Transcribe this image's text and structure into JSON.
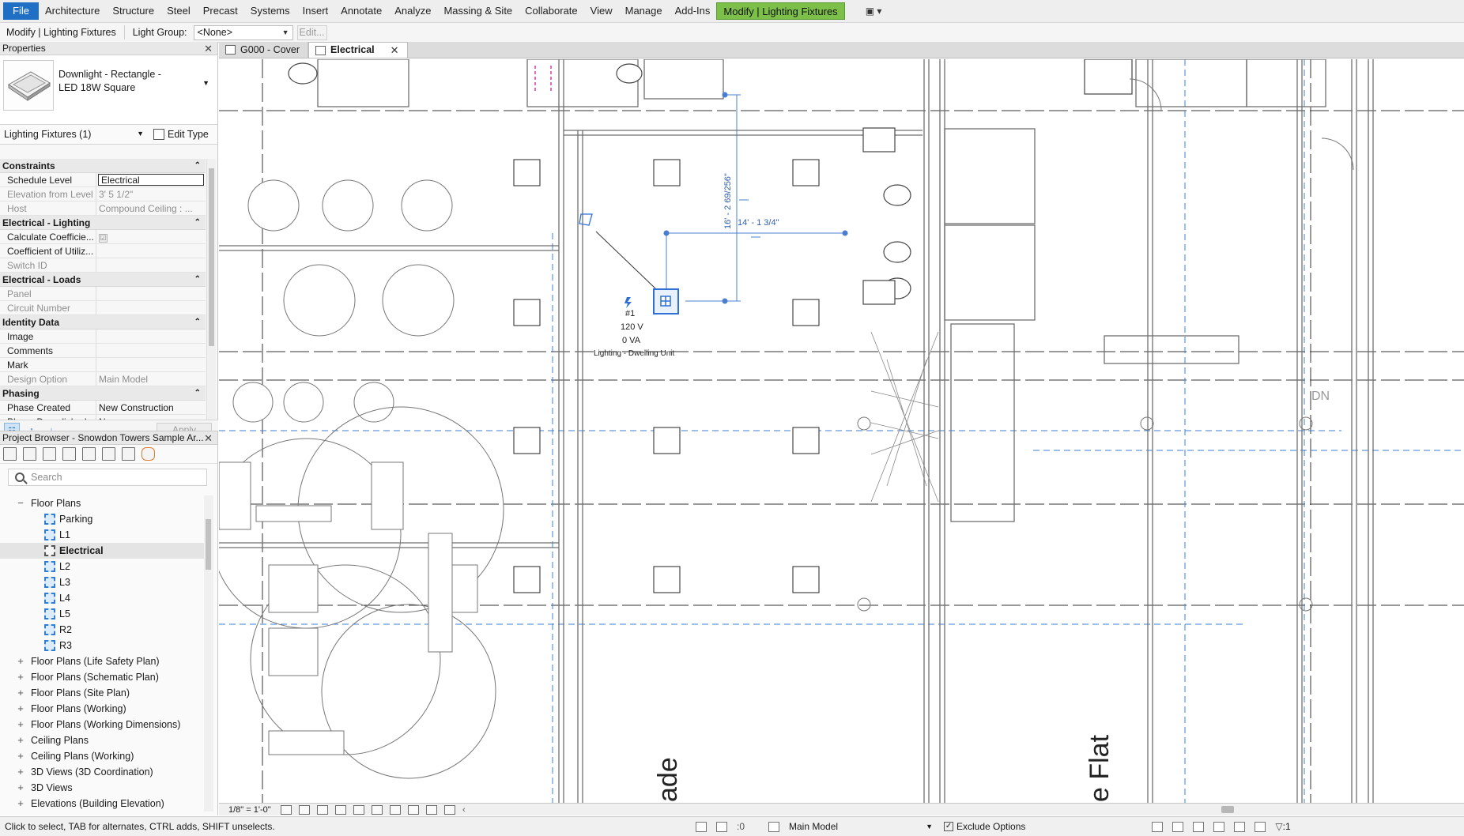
{
  "menu": {
    "file": "File",
    "tabs": [
      "Architecture",
      "Structure",
      "Steel",
      "Precast",
      "Systems",
      "Insert",
      "Annotate",
      "Analyze",
      "Massing & Site",
      "Collaborate",
      "View",
      "Manage",
      "Add-Ins"
    ],
    "context_tab": "Modify | Lighting Fixtures",
    "extra": "▣ ▾"
  },
  "options_bar": {
    "context": "Modify | Lighting Fixtures",
    "light_group_label": "Light Group:",
    "light_group_value": "<None>",
    "edit_button": "Edit..."
  },
  "properties": {
    "title": "Properties",
    "type_name": "Downlight - Rectangle - LED 18W Square",
    "instance_filter": "Lighting Fixtures (1)",
    "edit_type": "Edit Type",
    "groups": [
      {
        "name": "Constraints",
        "rows": [
          {
            "key": "Schedule Level",
            "value": "Electrical",
            "editing": true
          },
          {
            "key": "Elevation from Level",
            "value": "3'  5 1/2\"",
            "dim": true
          },
          {
            "key": "Host",
            "value": "Compound Ceiling : ...",
            "dim": true
          }
        ]
      },
      {
        "name": "Electrical - Lighting",
        "rows": [
          {
            "key": "Calculate Coefficie...",
            "value": "☑",
            "check": true
          },
          {
            "key": "Coefficient of Utiliz...",
            "value": ""
          },
          {
            "key": "Switch ID",
            "value": "",
            "dim": true
          }
        ]
      },
      {
        "name": "Electrical - Loads",
        "rows": [
          {
            "key": "Panel",
            "value": "",
            "dim": true
          },
          {
            "key": "Circuit Number",
            "value": "",
            "dim": true
          }
        ]
      },
      {
        "name": "Identity Data",
        "rows": [
          {
            "key": "Image",
            "value": ""
          },
          {
            "key": "Comments",
            "value": ""
          },
          {
            "key": "Mark",
            "value": ""
          },
          {
            "key": "Design Option",
            "value": "Main Model",
            "dim": true
          }
        ]
      },
      {
        "name": "Phasing",
        "rows": [
          {
            "key": "Phase Created",
            "value": "New Construction"
          },
          {
            "key": "Phase Demolished",
            "value": "None"
          }
        ]
      }
    ],
    "apply": "Apply"
  },
  "browser": {
    "title": "Project Browser - Snowdon Towers Sample Ar...",
    "search_placeholder": "Search",
    "items": [
      {
        "label": "Floor Plans",
        "level": 1,
        "exp": "−"
      },
      {
        "label": "Parking",
        "level": 2,
        "view": true
      },
      {
        "label": "L1",
        "level": 2,
        "view": true
      },
      {
        "label": "Electrical",
        "level": 2,
        "view": true,
        "selected": true
      },
      {
        "label": "L2",
        "level": 2,
        "view": true
      },
      {
        "label": "L3",
        "level": 2,
        "view": true
      },
      {
        "label": "L4",
        "level": 2,
        "view": true
      },
      {
        "label": "L5",
        "level": 2,
        "view": true
      },
      {
        "label": "R2",
        "level": 2,
        "view": true
      },
      {
        "label": "R3",
        "level": 2,
        "view": true
      },
      {
        "label": "Floor Plans (Life Safety Plan)",
        "level": 1,
        "exp": "+"
      },
      {
        "label": "Floor Plans (Schematic Plan)",
        "level": 1,
        "exp": "+"
      },
      {
        "label": "Floor Plans (Site Plan)",
        "level": 1,
        "exp": "+"
      },
      {
        "label": "Floor Plans (Working)",
        "level": 1,
        "exp": "+"
      },
      {
        "label": "Floor Plans (Working Dimensions)",
        "level": 1,
        "exp": "+"
      },
      {
        "label": "Ceiling Plans",
        "level": 1,
        "exp": "+"
      },
      {
        "label": "Ceiling Plans (Working)",
        "level": 1,
        "exp": "+"
      },
      {
        "label": "3D Views (3D Coordination)",
        "level": 1,
        "exp": "+"
      },
      {
        "label": "3D Views",
        "level": 1,
        "exp": "+"
      },
      {
        "label": "Elevations (Building Elevation)",
        "level": 1,
        "exp": "+"
      }
    ]
  },
  "view_tabs": [
    {
      "label": "G000 - Cover",
      "active": false
    },
    {
      "label": "Electrical",
      "active": true
    }
  ],
  "canvas": {
    "dim_vertical": "16' - 2 69/256\"",
    "dim_horizontal": "14' - 1 3/4\"",
    "tag_number": "#1",
    "tag_voltage": "120 V",
    "tag_load": "0 VA",
    "tag_type": "Lighting - Dwelling Unit",
    "stair_label": "DN",
    "room_text_1": "ade",
    "room_text_2": "e Flat"
  },
  "view_control": {
    "scale": "1/8\" = 1'-0\""
  },
  "status": {
    "message": "Click to select, TAB for alternates, CTRL adds, SHIFT unselects.",
    "selection_count": ":0",
    "workset": "Main Model",
    "exclude_options": "Exclude Options",
    "filter_count": ":1"
  },
  "colors": {
    "accent": "#1f6fc5",
    "context_tab": "#7cc04a",
    "selection_blue": "#2f6fd6",
    "drawing_gray": "#6f6f6f"
  }
}
